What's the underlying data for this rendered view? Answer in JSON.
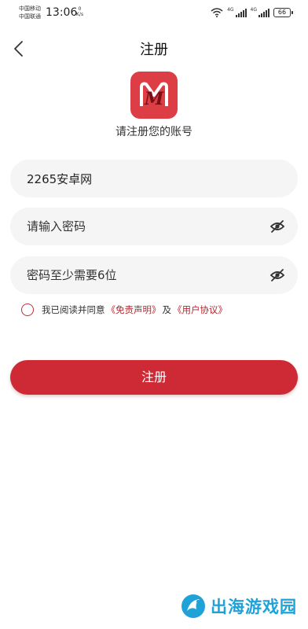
{
  "status_bar": {
    "carrier_1": "中国移动",
    "carrier_2": "中国联通",
    "time": "13:06",
    "net_speed_value": "0",
    "net_speed_unit": "K/s",
    "network_1": "4G",
    "network_2": "4G",
    "battery": "66"
  },
  "header": {
    "title": "注册",
    "logo_letter": "M",
    "subtitle": "请注册您的账号"
  },
  "form": {
    "username_value": "2265安卓网",
    "password_placeholder": "请输入密码",
    "confirm_placeholder": "密码至少需要6位"
  },
  "agreement": {
    "prefix": "我已阅读并同意",
    "disclaimer_link": "《免责声明》",
    "conjunction": "及",
    "user_agreement_link": "《用户协议》",
    "checked": false
  },
  "register_button": "注册",
  "watermark": "出海游戏园",
  "colors": {
    "accent": "#ce2a36",
    "logo_bg": "#dd3e46",
    "field_bg": "#f5f5f5",
    "link": "#b8232e",
    "watermark": "#1fa2d8"
  }
}
